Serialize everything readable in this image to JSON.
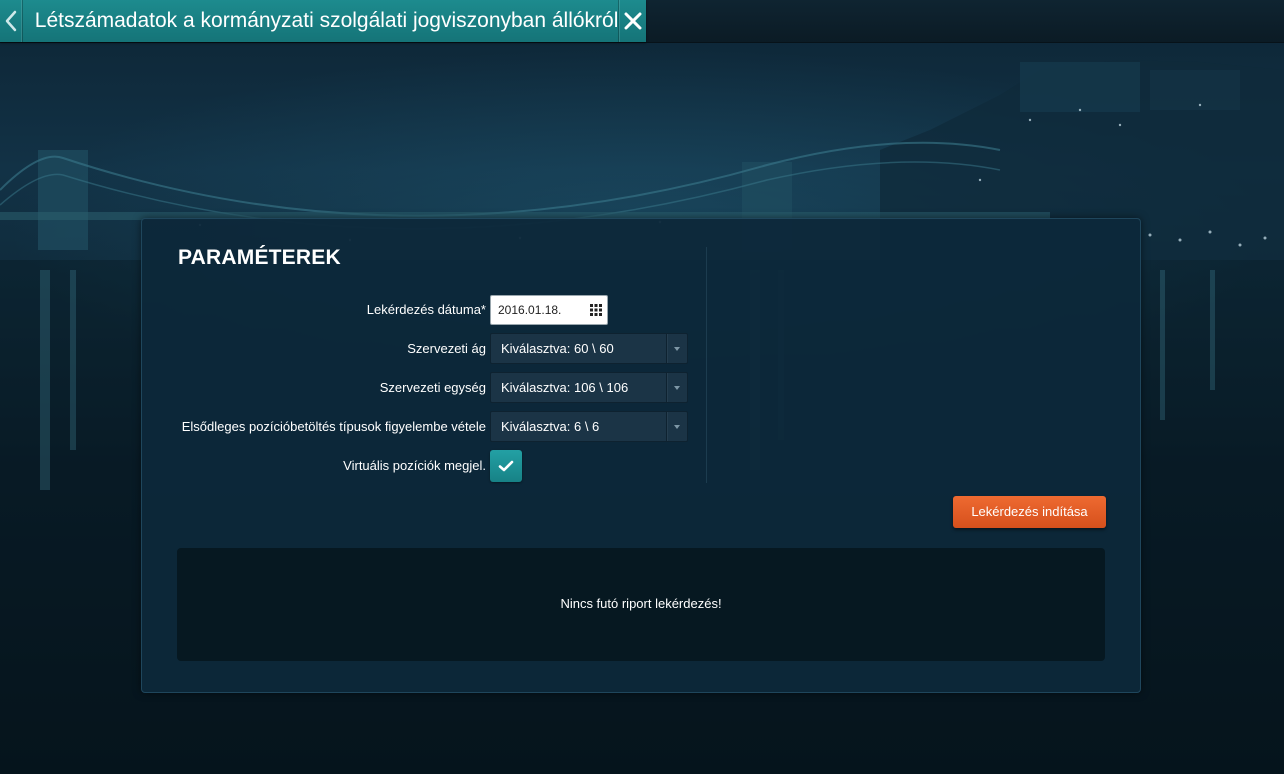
{
  "header": {
    "title": "Létszámadatok a kormányzati szolgálati jogviszonyban állókról",
    "back_icon": "chevron-left-icon",
    "close_icon": "close-icon"
  },
  "panel": {
    "title": "PARAMÉTEREK",
    "fields": {
      "date": {
        "label": "Lekérdezés dátuma*",
        "value": "2016.01.18.",
        "icon": "calendar-icon"
      },
      "branch": {
        "label": "Szervezeti ág",
        "value": "Kiválasztva: 60 \\ 60"
      },
      "unit": {
        "label": "Szervezeti egység",
        "value": "Kiválasztva: 106 \\ 106"
      },
      "position_types": {
        "label": "Elsődleges pozícióbetöltés típusok figyelembe vétele",
        "value": "Kiválasztva: 6 \\ 6"
      },
      "virtual_positions": {
        "label": "Virtuális pozíciók megjel.",
        "checked": true
      }
    },
    "run_button": "Lekérdezés indítása",
    "status_message": "Nincs futó riport lekérdezés!"
  },
  "colors": {
    "accent_teal": "#1d8b8e",
    "action_orange": "#e35f27",
    "panel_bg": "#0d283a"
  }
}
